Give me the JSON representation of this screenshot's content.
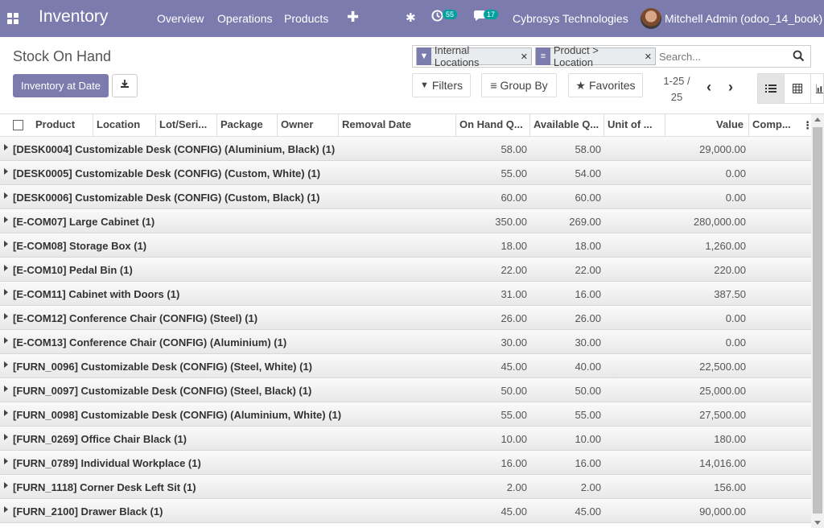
{
  "colors": {
    "brand": "#7c7bad",
    "badge": "#00a09d"
  },
  "nav": {
    "app_name": "Inventory",
    "menu": [
      "Overview",
      "Operations",
      "Products"
    ],
    "activity_count": "55",
    "message_count": "17",
    "company": "Cybrosys Technologies",
    "user": "Mitchell Admin (odoo_14_book)"
  },
  "control": {
    "title": "Stock On Hand",
    "inventory_at_date": "Inventory at Date",
    "facets": [
      {
        "icon": "filter-icon",
        "label": "Internal Locations"
      },
      {
        "icon": "group-icon",
        "label": "Product > Location"
      }
    ],
    "search_placeholder": "Search...",
    "filters": "Filters",
    "group_by": "Group By",
    "favorites": "Favorites",
    "pager_line1": "1-25 /",
    "pager_line2": "25"
  },
  "table": {
    "columns": [
      "Product",
      "Location",
      "Lot/Seri...",
      "Package",
      "Owner",
      "Removal Date",
      "On Hand Q...",
      "Available Q...",
      "Unit of ...",
      "Value",
      "Comp..."
    ],
    "rows": [
      {
        "name": "[DESK0004] Customizable Desk (CONFIG) (Aluminium, Black) (1)",
        "on_hand": "58.00",
        "available": "58.00",
        "value": "29,000.00"
      },
      {
        "name": "[DESK0005] Customizable Desk (CONFIG) (Custom, White) (1)",
        "on_hand": "55.00",
        "available": "54.00",
        "value": "0.00"
      },
      {
        "name": "[DESK0006] Customizable Desk (CONFIG) (Custom, Black) (1)",
        "on_hand": "60.00",
        "available": "60.00",
        "value": "0.00"
      },
      {
        "name": "[E-COM07] Large Cabinet (1)",
        "on_hand": "350.00",
        "available": "269.00",
        "value": "280,000.00"
      },
      {
        "name": "[E-COM08] Storage Box (1)",
        "on_hand": "18.00",
        "available": "18.00",
        "value": "1,260.00"
      },
      {
        "name": "[E-COM10] Pedal Bin (1)",
        "on_hand": "22.00",
        "available": "22.00",
        "value": "220.00"
      },
      {
        "name": "[E-COM11] Cabinet with Doors (1)",
        "on_hand": "31.00",
        "available": "16.00",
        "value": "387.50"
      },
      {
        "name": "[E-COM12] Conference Chair (CONFIG) (Steel) (1)",
        "on_hand": "26.00",
        "available": "26.00",
        "value": "0.00"
      },
      {
        "name": "[E-COM13] Conference Chair (CONFIG) (Aluminium) (1)",
        "on_hand": "30.00",
        "available": "30.00",
        "value": "0.00"
      },
      {
        "name": "[FURN_0096] Customizable Desk (CONFIG) (Steel, White) (1)",
        "on_hand": "45.00",
        "available": "40.00",
        "value": "22,500.00"
      },
      {
        "name": "[FURN_0097] Customizable Desk (CONFIG) (Steel, Black) (1)",
        "on_hand": "50.00",
        "available": "50.00",
        "value": "25,000.00"
      },
      {
        "name": "[FURN_0098] Customizable Desk (CONFIG) (Aluminium, White) (1)",
        "on_hand": "55.00",
        "available": "55.00",
        "value": "27,500.00"
      },
      {
        "name": "[FURN_0269] Office Chair Black (1)",
        "on_hand": "10.00",
        "available": "10.00",
        "value": "180.00"
      },
      {
        "name": "[FURN_0789] Individual Workplace (1)",
        "on_hand": "16.00",
        "available": "16.00",
        "value": "14,016.00"
      },
      {
        "name": "[FURN_1118] Corner Desk Left Sit (1)",
        "on_hand": "2.00",
        "available": "2.00",
        "value": "156.00"
      },
      {
        "name": "[FURN_2100] Drawer Black (1)",
        "on_hand": "45.00",
        "available": "45.00",
        "value": "90,000.00"
      }
    ]
  }
}
